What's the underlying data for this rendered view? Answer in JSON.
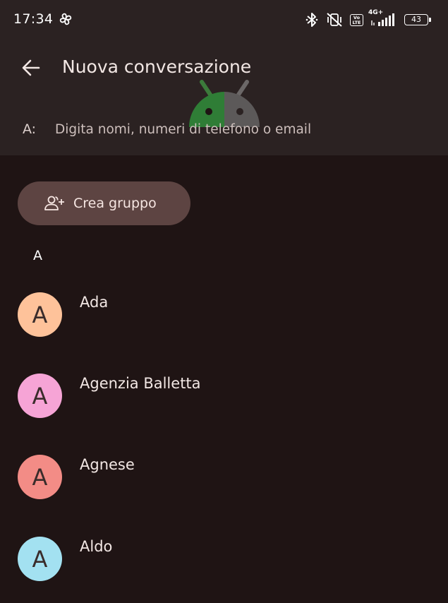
{
  "status_bar": {
    "time": "17:34",
    "network": "4G+",
    "volte": "Vo LTE",
    "battery": "43"
  },
  "app_bar": {
    "title": "Nuova conversazione"
  },
  "recipient": {
    "label": "A:",
    "placeholder": "Digita nomi, numeri di telefono o email"
  },
  "create_group": {
    "label": "Crea gruppo"
  },
  "contacts_section": {
    "header": "A",
    "contacts": [
      {
        "initial": "A",
        "name": "Ada",
        "avatar_color": "#fec29a"
      },
      {
        "initial": "A",
        "name": "Agenzia Balletta",
        "avatar_color": "#f6a4d6"
      },
      {
        "initial": "A",
        "name": "Agnese",
        "avatar_color": "#f38c86"
      },
      {
        "initial": "A",
        "name": "Aldo",
        "avatar_color": "#a3e1f1"
      }
    ]
  },
  "icons": {
    "fan": "fan-icon",
    "bluetooth": "bluetooth-icon",
    "vibrate_off": "vibrate-off-icon",
    "signal": "signal-icon",
    "back": "arrow-back-icon",
    "group_add": "group-add-icon",
    "watermark": "android-logo"
  },
  "colors": {
    "background": "#1f1414",
    "top_surface": "#2b2222",
    "group_button": "#5d4442",
    "text": "#f2e7e4"
  }
}
